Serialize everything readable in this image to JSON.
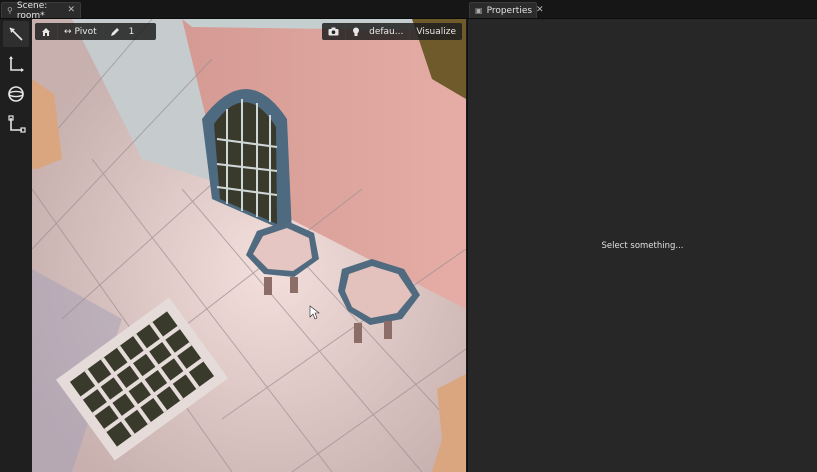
{
  "tabs": {
    "scene_title": "Scene: room*",
    "properties_title": "Properties"
  },
  "viewport_toolbar": {
    "home_icon": "home-icon",
    "pivot_label": "Pivot",
    "brush_value": "1",
    "light_label": "defau...",
    "visualize_label": "Visualize"
  },
  "tools": [
    {
      "name": "select-tool",
      "icon": "arrow-icon"
    },
    {
      "name": "move-tool",
      "icon": "axis-move-icon"
    },
    {
      "name": "rotate-tool",
      "icon": "sphere-rotate-icon"
    },
    {
      "name": "scale-tool",
      "icon": "axis-scale-icon"
    }
  ],
  "properties": {
    "empty_hint": "Select something..."
  }
}
